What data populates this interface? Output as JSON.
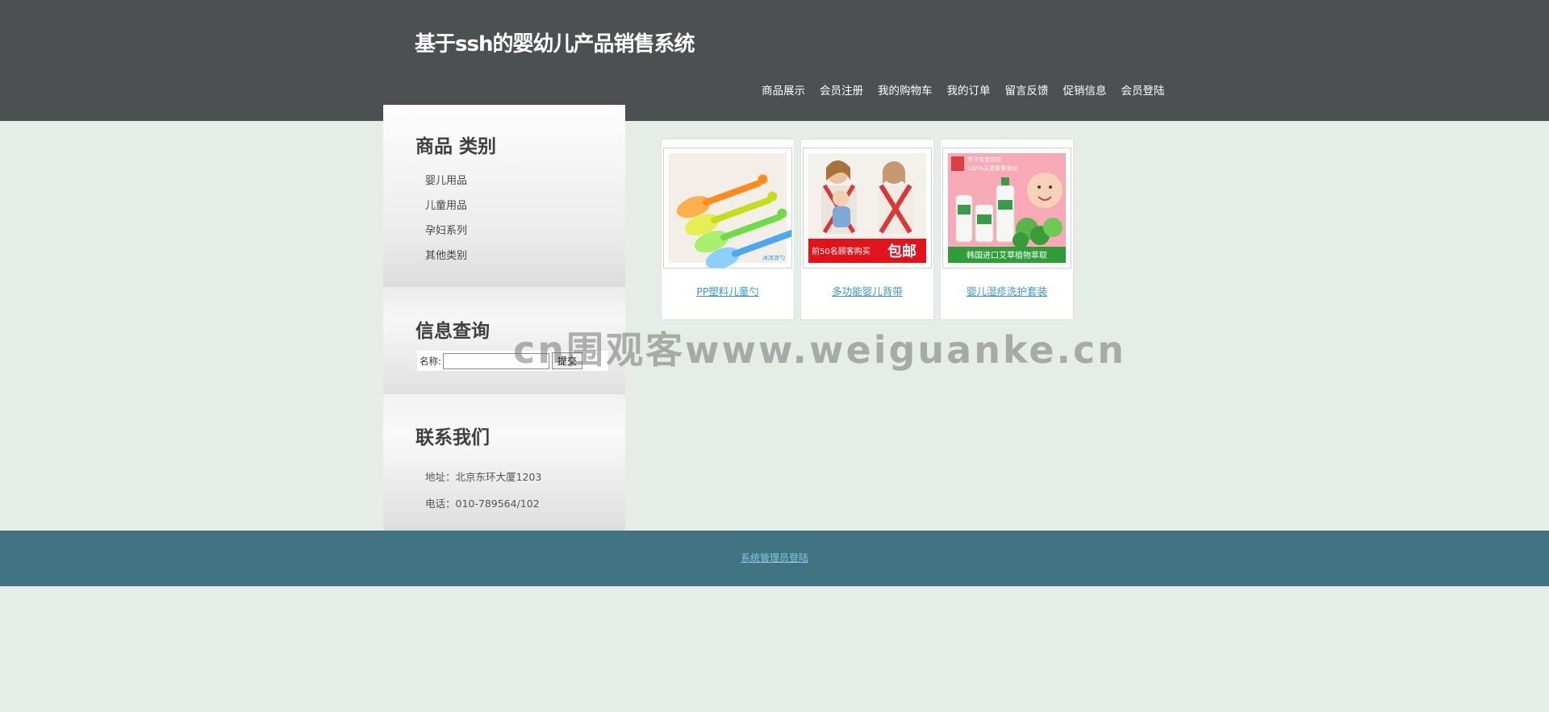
{
  "header": {
    "title": "基于ssh的婴幼儿产品销售系统",
    "nav": [
      "商品展示",
      "会员注册",
      "我的购物车",
      "我的订单",
      "留言反馈",
      "促销信息",
      "会员登陆"
    ]
  },
  "sidebar": {
    "categories": {
      "title": "商品 类别",
      "items": [
        "婴儿用品",
        "儿童用品",
        "孕妇系列",
        "其他类别"
      ]
    },
    "search": {
      "title": "信息查询",
      "name_label": "名称:",
      "name_value": "",
      "submit_label": "提交"
    },
    "contact": {
      "title": "联系我们",
      "address": "地址：北京东环大厦1203",
      "phone": "电话：010-789564/102"
    }
  },
  "products": [
    {
      "name": "PP塑料儿童勺",
      "image": "spoon-image",
      "image_text": "冰凉凉勺"
    },
    {
      "name": "多功能婴儿背带",
      "image": "baby-carrier-image",
      "image_text": "前50名顾客购买",
      "image_badge": "包邮"
    },
    {
      "name": "婴儿湿疹洗护套装",
      "image": "baby-care-set-image",
      "image_text": "韩国进口艾草植物萃取",
      "image_line1": "专注宝宝湿疹",
      "image_line2": "100%无激素零添加"
    }
  ],
  "footer": {
    "admin_link": "系统管理员登陆"
  },
  "watermark": "cn围观客www.weiguanke.cn",
  "colors": {
    "header_bg": "#4d5051",
    "page_bg": "#e6ece6",
    "footer_bg": "#417482",
    "link": "#3c97c6"
  }
}
